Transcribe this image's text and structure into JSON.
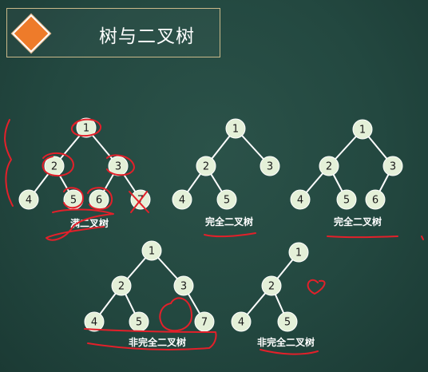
{
  "slide": {
    "title": "树与二叉树",
    "accent_color": "#ee7b2a",
    "board_color": "#234840",
    "annotation_color": "#e3202a"
  },
  "trees": [
    {
      "caption": "满二叉树",
      "nodes": [
        "1",
        "2",
        "3",
        "4",
        "5",
        "6",
        "7"
      ],
      "edges": [
        [
          0,
          1
        ],
        [
          0,
          2
        ],
        [
          1,
          3
        ],
        [
          1,
          4
        ],
        [
          2,
          5
        ],
        [
          2,
          6
        ]
      ]
    },
    {
      "caption": "完全二叉树",
      "nodes": [
        "1",
        "2",
        "3",
        "4",
        "5"
      ],
      "edges": [
        [
          0,
          1
        ],
        [
          0,
          2
        ],
        [
          1,
          3
        ],
        [
          1,
          4
        ]
      ]
    },
    {
      "caption": "完全二叉树",
      "nodes": [
        "1",
        "2",
        "3",
        "4",
        "5",
        "6"
      ],
      "edges": [
        [
          0,
          1
        ],
        [
          0,
          2
        ],
        [
          1,
          3
        ],
        [
          1,
          4
        ],
        [
          2,
          5
        ]
      ]
    },
    {
      "caption": "非完全二叉树",
      "nodes": [
        "1",
        "2",
        "3",
        "4",
        "5",
        "7"
      ],
      "edges": [
        [
          0,
          1
        ],
        [
          0,
          2
        ],
        [
          1,
          3
        ],
        [
          1,
          4
        ],
        [
          2,
          5
        ]
      ]
    },
    {
      "caption": "非完全二叉树",
      "nodes": [
        "1",
        "2",
        "4",
        "5"
      ],
      "edges": [
        [
          0,
          1
        ],
        [
          1,
          2
        ],
        [
          1,
          3
        ]
      ]
    }
  ]
}
